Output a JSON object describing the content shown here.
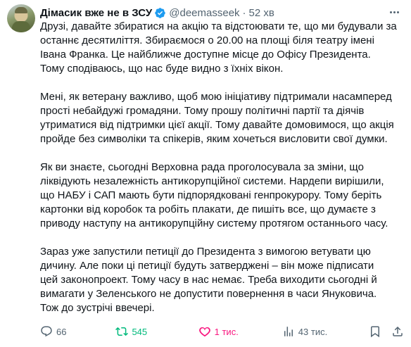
{
  "author": {
    "name": "Дімасик вже не в ЗСУ",
    "handle": "@deemasseek",
    "separator": "·",
    "time": "52 хв",
    "verified_color": "#1d9bf0"
  },
  "tweet": {
    "paragraphs": [
      {
        "lines": [
          "Друзі, давайте збиратися на акцію та відстоювати те, що ми будували за",
          "останнє десятиліття. Збираємося о 20.00 на площі біля театру імені",
          "Івана Франка. Це найближче доступне місце до Офісу Президента.",
          "Тому сподіваюсь, що нас буде видно з їхніх вікон."
        ]
      },
      {
        "lines": [
          "Мені, як ветерану важливо, щоб мою ініціативу підтримали насамперед",
          "прості небайдужі громадяни. Тому прошу політичні партії та діячів",
          "утриматися від підтримки цієї акції. Тому давайте домовимося, що акція",
          "пройде без символіки та спікерів, яким хочеться висловити свої думки."
        ]
      },
      {
        "lines": [
          "Як ви знаєте, сьогодні Верховна рада проголосувала за зміни, що",
          "ліквідують незалежність антикорупційної системи. Нардепи вирішили,",
          "що НАБУ і САП мають бути підпорядковані генпрокурору. Тому беріть",
          "картонки від коробок та робіть плакати, де пишіть все, що думаєте з",
          "приводу наступу на антикорупційну систему протягом останнього часу."
        ]
      },
      {
        "lines": [
          "Зараз уже запустили петиції до Президента з вимогою ветувати цю",
          "дичину. Але поки ці петиції будуть затверджені – він може підписати",
          "цей законопроект. Тому часу в нас немає. Треба виходити сьогодні й",
          "вимагати у Зеленського не допустити повернення в часи Януковича.",
          "Тож до зустрічі ввечері."
        ]
      }
    ]
  },
  "actions": {
    "replies": "66",
    "retweets": "545",
    "likes": "1 тис.",
    "views": "43 тис.",
    "retweet_color": "#00ba7c",
    "like_color": "#f91880",
    "muted_color": "#536471"
  },
  "icons": [
    "verified-badge-icon",
    "more-icon",
    "reply-icon",
    "retweet-icon",
    "like-icon",
    "views-icon",
    "bookmark-icon",
    "share-icon"
  ]
}
